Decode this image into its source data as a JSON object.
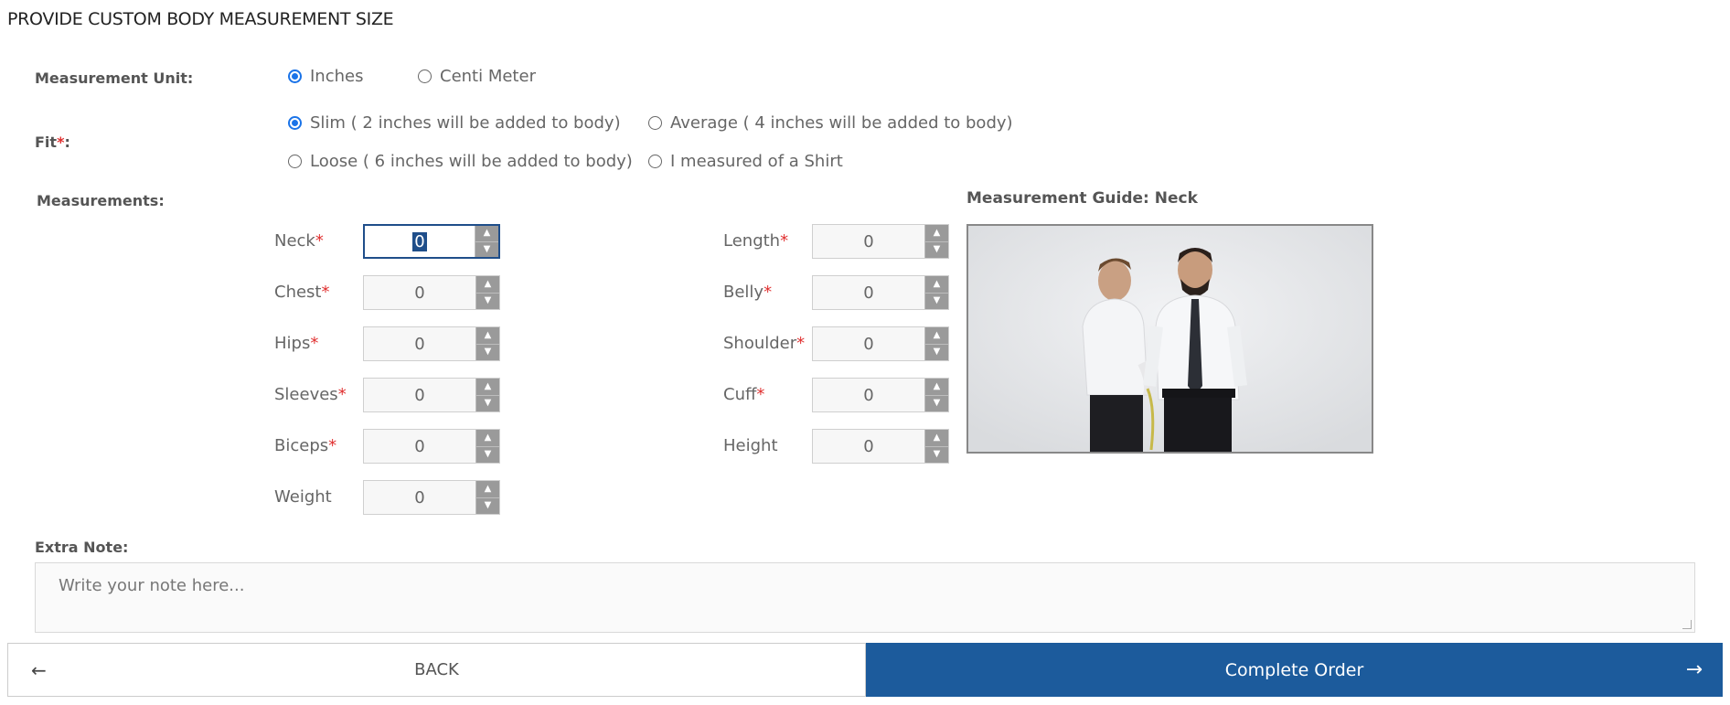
{
  "title": "PROVIDE CUSTOM BODY MEASUREMENT SIZE",
  "unit": {
    "label": "Measurement Unit:",
    "options": [
      "Inches",
      "Centi Meter"
    ],
    "selected": "Inches"
  },
  "fit": {
    "label": "Fit",
    "required_mark": "*",
    "colon": ":",
    "options": [
      "Slim ( 2 inches will be added to body)",
      "Average ( 4 inches will be added to body)",
      "Loose ( 6 inches will be added to body)",
      "I measured of a Shirt"
    ],
    "selected": "Slim ( 2 inches will be added to body)"
  },
  "measurements": {
    "label": "Measurements:",
    "left": [
      {
        "name": "Neck",
        "required": "*",
        "value": "0"
      },
      {
        "name": "Chest",
        "required": "*",
        "value": "0"
      },
      {
        "name": "Hips",
        "required": "*",
        "value": "0"
      },
      {
        "name": "Sleeves",
        "required": "*",
        "value": "0"
      },
      {
        "name": "Biceps",
        "required": "*",
        "value": "0"
      },
      {
        "name": "Weight",
        "required": "",
        "value": "0"
      }
    ],
    "right": [
      {
        "name": "Length",
        "required": "*",
        "value": "0"
      },
      {
        "name": "Belly",
        "required": "*",
        "value": "0"
      },
      {
        "name": "Shoulder",
        "required": "*",
        "value": "0"
      },
      {
        "name": "Cuff",
        "required": "*",
        "value": "0"
      },
      {
        "name": "Height",
        "required": "",
        "value": "0"
      }
    ]
  },
  "guide": {
    "title": "Measurement Guide: Neck"
  },
  "note": {
    "label": "Extra Note:",
    "placeholder": "Write your note here..."
  },
  "buttons": {
    "back": "BACK",
    "back_arrow": "←",
    "complete": "Complete Order",
    "complete_arrow": "→"
  },
  "colors": {
    "accent": "#1c5b9c",
    "required": "#e03030",
    "radio_checked": "#1a73e8"
  }
}
